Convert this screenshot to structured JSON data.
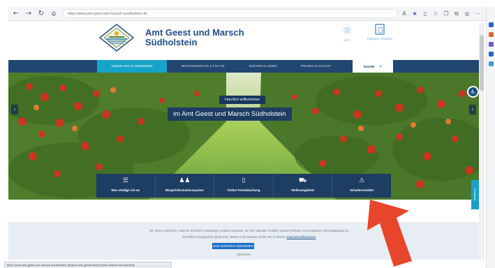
{
  "browser": {
    "url": "https://www.amt-geest-und-marsch-suedholstein.de",
    "status_url": "https://www.amt-geest-und-marsch-suedholstein.de/start-amt-gemeinden/herzlich-willkommen/quicklink"
  },
  "header": {
    "title_line1": "Amt Geest und Marsch",
    "title_line2": "Südholstein",
    "weather_temp": "16°C",
    "digital_label": "Digitales Amtsplan",
    "brand_color": "#1f4e86"
  },
  "nav": {
    "items": [
      {
        "label": "Unser Amt & Gemeinden",
        "active": true
      },
      {
        "label": "Bürgerservice & Politik",
        "active": false
      },
      {
        "label": "Wohnen & Leben",
        "active": false
      },
      {
        "label": "Freizeit & Kultur",
        "active": false
      }
    ],
    "search_label": "SUCHE"
  },
  "hero": {
    "welcome": "Herzlich willkommen",
    "title": "im Amt Geest und Marsch Südholstein"
  },
  "quicklinks": [
    {
      "label": "Was erledige ich wo",
      "icon": "list-icon"
    },
    {
      "label": "Bürgerinformationssystem",
      "icon": "people-icon"
    },
    {
      "label": "Online-Terminbuchung",
      "icon": "phone-icon"
    },
    {
      "label": "Stellenangebote",
      "icon": "car-icon"
    },
    {
      "label": "Schadensmelder",
      "icon": "warning-icon"
    }
  ],
  "side_tab": "Feedback",
  "cookie": {
    "text_line1": "Wir setzen darauf hin, dass wir technisch notwendige Cookies einsetzen, um eine optimale Funktion unserer Website zu ermöglichen. Die Bestätigung zur",
    "text_line2": "bis Widerruf gespeichert (jederzeit). Weitere Informationen finden Sie in unserer",
    "link": "Datenschutzhinweisen",
    "button": "ZUR KENNTNIS GENOMMEN",
    "imprint": "Impressum"
  },
  "colors": {
    "nav_bg": "#21466f",
    "nav_active": "#17a2c8",
    "annotation": "#e8462c"
  }
}
